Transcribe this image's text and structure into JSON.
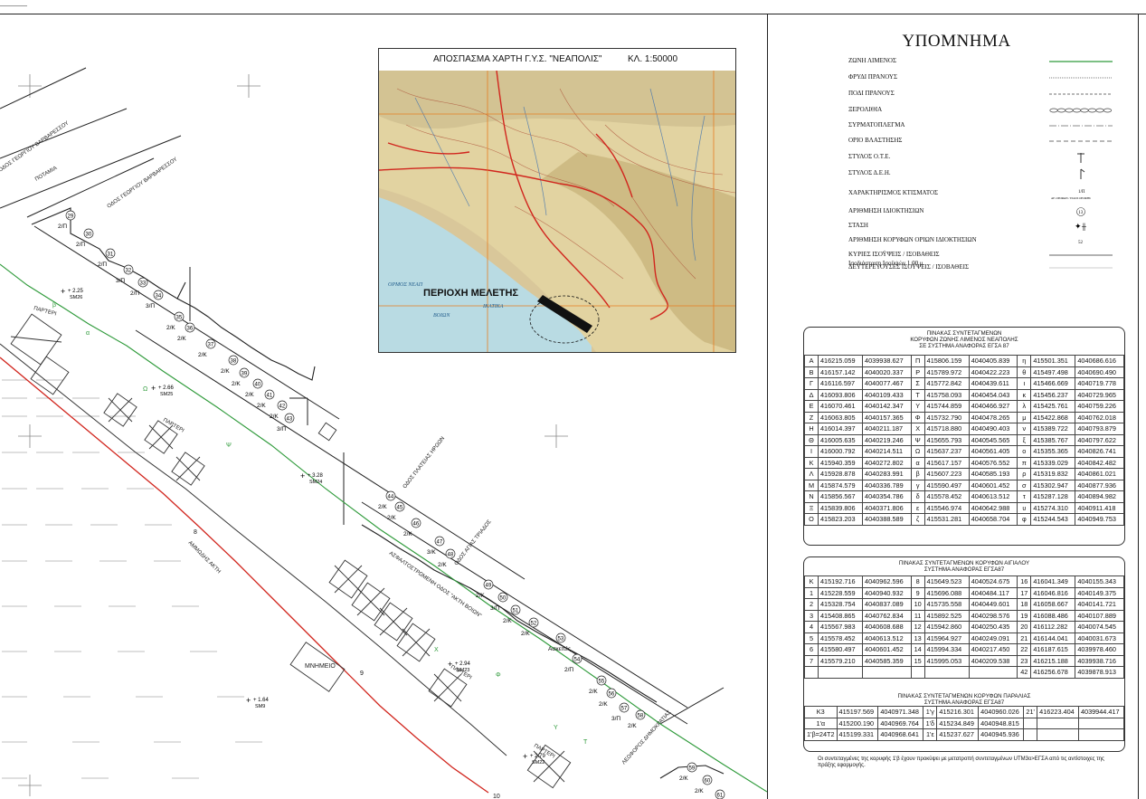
{
  "inset": {
    "title": "ΑΠΟΣΠΑΣΜΑ ΧΑΡΤΗ Γ.Υ.Σ. \"ΝΕΑΠΟΛΙΣ\"",
    "scale": "ΚΛ. 1:50000",
    "study_area_label": "ΠΕΡΙΟΧΗ ΜΕΛΕΤΗΣ",
    "sea_labels": [
      "ΟΡΜΟΣ ΝΕΑΠ",
      "ΒΟΙΩΝ",
      "ΙΚΑΤΙΚΑ"
    ]
  },
  "legend": {
    "title": "ΥΠΟΜΝΗΜΑ",
    "items": [
      {
        "label": "ΖΩΝΗ ΛΙΜΕΝΟΣ",
        "icon": "green-line"
      },
      {
        "label": "ΦΡΥΔΙ ΠΡΑΝΟΥΣ",
        "icon": "hatched-line"
      },
      {
        "label": "ΠΟΔΙ ΠΡΑΝΟΥΣ",
        "icon": "dashed-line"
      },
      {
        "label": "ΞΕΡΟΛΙΘΙΑ",
        "icon": "stone-wall"
      },
      {
        "label": "ΣΥΡΜΑΤΟΠΛΕΓΜΑ",
        "icon": "wire-fence"
      },
      {
        "label": "ΟΡΙΟ ΒΛΑΣΤΗΣΗΣ",
        "icon": "dash-line"
      },
      {
        "label": "ΣΤΥΛΟΣ Ο.Τ.Ε.",
        "icon": "ote-pole"
      },
      {
        "label": "ΣΤΥΛΟΣ Δ.Ε.Η.",
        "icon": "dei-pole"
      },
      {
        "label": "ΧΑΡΑΚΤΗΡΙΣΜΟΣ ΚΤΙΣΜΑΤΟΣ",
        "icon": "building-code",
        "symbol_text": "1/Π",
        "symbol_caption": "ΑΡ. ΟΡΟΦΩΝ / ΕΙΔΟΣ ΟΡΟΦΗΣ"
      },
      {
        "label": "ΑΡΙΘΜΗΣΗ ΙΔΙΟΚΤΗΣΙΩΝ",
        "icon": "circled-number",
        "symbol_text": "13"
      },
      {
        "label": "ΣΤΑΣΗ",
        "icon": "station"
      },
      {
        "label": "ΑΡΙΘΜΗΣΗ ΚΟΡΥΦΩΝ ΟΡΙΩΝ ΙΔΙΟΚΤΗΣΙΩΝ",
        "icon": "vertex-number",
        "symbol_text": "52"
      },
      {
        "label": "ΚΥΡΙΕΣ ΙΣΟΫΨΕΙΣ / ΙΣΟΒΑΘΕΙΣ",
        "icon": "solid-line"
      },
      {
        "label": "ΔΕΥΤΕΡΕΥΟΥΣΕΣ ΙΣΟΫΨΕΙΣ / ΙΣΟΒΑΘΕΙΣ",
        "icon": "thin-line"
      }
    ],
    "note": "Ισοδιάσταση Ισοϋψών 1.00 μ."
  },
  "table1": {
    "title_lines": [
      "ΠΙΝΑΚΑΣ ΣΥΝΤΕΤΑΓΜΕΝΩΝ",
      "ΚΟΡΥΦΩΝ ΖΩΝΗΣ ΛΙΜΕΝΟΣ ΝΕΑΠΟΛΗΣ",
      "ΣΕ ΣΥΣΤΗΜΑ ΑΝΑΦΟΡΑΣ ΕΓΣΑ 87"
    ],
    "rows": [
      [
        "Α",
        "416215.059",
        "4039938.627",
        "Π",
        "415806.159",
        "4040405.839",
        "η",
        "415501.351",
        "4040686.616"
      ],
      [
        "Β",
        "416157.142",
        "4040020.337",
        "Ρ",
        "415789.972",
        "4040422.223",
        "θ",
        "415497.498",
        "4040690.490"
      ],
      [
        "Γ",
        "416116.597",
        "4040077.467",
        "Σ",
        "415772.842",
        "4040439.611",
        "ι",
        "415466.669",
        "4040719.778"
      ],
      [
        "Δ",
        "416093.806",
        "4040109.433",
        "Τ",
        "415758.093",
        "4040454.043",
        "κ",
        "415456.237",
        "4040729.965"
      ],
      [
        "Ε",
        "416070.461",
        "4040142.347",
        "Υ",
        "415744.859",
        "4040466.927",
        "λ",
        "415425.761",
        "4040759.226"
      ],
      [
        "Ζ",
        "416063.805",
        "4040157.365",
        "Φ",
        "415732.790",
        "4040478.265",
        "μ",
        "415422.868",
        "4040762.018"
      ],
      [
        "Η",
        "416014.397",
        "4040211.187",
        "Χ",
        "415718.880",
        "4040490.403",
        "ν",
        "415389.722",
        "4040793.879"
      ],
      [
        "Θ",
        "416005.635",
        "4040219.246",
        "Ψ",
        "415655.793",
        "4040545.565",
        "ξ",
        "415385.767",
        "4040797.622"
      ],
      [
        "Ι",
        "416000.792",
        "4040214.511",
        "Ω",
        "415637.237",
        "4040561.405",
        "ο",
        "415355.365",
        "4040826.741"
      ],
      [
        "Κ",
        "415940.359",
        "4040272.802",
        "α",
        "415617.157",
        "4040576.552",
        "π",
        "415339.029",
        "4040842.482"
      ],
      [
        "Λ",
        "415928.878",
        "4040283.991",
        "β",
        "415607.223",
        "4040585.193",
        "ρ",
        "415319.832",
        "4040861.021"
      ],
      [
        "Μ",
        "415874.579",
        "4040336.789",
        "γ",
        "415590.497",
        "4040601.452",
        "σ",
        "415302.947",
        "4040877.936"
      ],
      [
        "Ν",
        "415856.567",
        "4040354.786",
        "δ",
        "415578.452",
        "4040613.512",
        "τ",
        "415287.128",
        "4040894.982"
      ],
      [
        "Ξ",
        "415839.806",
        "4040371.806",
        "ε",
        "415546.974",
        "4040642.988",
        "υ",
        "415274.310",
        "4040911.418"
      ],
      [
        "Ο",
        "415823.203",
        "4040388.589",
        "ζ",
        "415531.281",
        "4040658.704",
        "φ",
        "415244.543",
        "4040949.753"
      ]
    ]
  },
  "table2": {
    "title_lines": [
      "ΠΙΝΑΚΑΣ ΣΥΝΤΕΤΑΓΜΕΝΩΝ ΚΟΡΥΦΩΝ ΑΙΓΙΑΛΟΥ",
      "ΣΥΣΤΗΜΑ ΑΝΑΦΟΡΑΣ ΕΓΣΑ87"
    ],
    "rows": [
      [
        "Κ",
        "415192.716",
        "4040962.596",
        "8",
        "415649.523",
        "4040524.675",
        "16",
        "416041.349",
        "4040155.343"
      ],
      [
        "1",
        "415228.559",
        "4040940.932",
        "9",
        "415696.088",
        "4040484.117",
        "17",
        "416046.816",
        "4040149.375"
      ],
      [
        "2",
        "415328.754",
        "4040837.089",
        "10",
        "415735.558",
        "4040449.601",
        "18",
        "416058.667",
        "4040141.721"
      ],
      [
        "3",
        "415408.865",
        "4040762.834",
        "11",
        "415892.525",
        "4040298.576",
        "19",
        "416088.486",
        "4040107.889"
      ],
      [
        "4",
        "415567.983",
        "4040608.688",
        "12",
        "415942.860",
        "4040250.435",
        "20",
        "416112.282",
        "4040074.545"
      ],
      [
        "5",
        "415578.452",
        "4040613.512",
        "13",
        "415964.927",
        "4040249.091",
        "21",
        "416144.041",
        "4040031.673"
      ],
      [
        "6",
        "415580.497",
        "4040601.452",
        "14",
        "415994.334",
        "4040217.450",
        "22",
        "416187.615",
        "4039978.460"
      ],
      [
        "7",
        "415579.210",
        "4040585.359",
        "15",
        "415995.053",
        "4040209.538",
        "23",
        "416215.188",
        "4039938.716"
      ],
      [
        "",
        "",
        "",
        "",
        "",
        "",
        "42",
        "416256.678",
        "4039878.913"
      ]
    ],
    "sub_title_lines": [
      "ΠΙΝΑΚΑΣ ΣΥΝΤΕΤΑΓΜΕΝΩΝ ΚΟΡΥΦΩΝ ΠΑΡΑΛΙΑΣ",
      "ΣΥΣΤΗΜΑ ΑΝΑΦΟΡΑΣ ΕΓΣΑ87"
    ],
    "sub_rows": [
      [
        "Κ3",
        "415197.569",
        "4040971.348",
        "1'γ",
        "415216.301",
        "4040960.026",
        "21'",
        "416223.404",
        "4039944.417"
      ],
      [
        "1'α",
        "415200.190",
        "4040969.764",
        "1'δ",
        "415234.849",
        "4040948.815",
        "",
        "",
        ""
      ],
      [
        "1'β=24Τ2",
        "415199.331",
        "4040968.641",
        "1'ε",
        "415237.627",
        "4040945.936",
        "",
        "",
        ""
      ]
    ]
  },
  "footnote": "Οι συντεταγμένες της κορυφής 1'β έχουν προκύψει με μετατροπή συντεταγμένων UTM3o>ΕΓΣΑ από τις αντίστοιχες της πράξης εφαρμογής.",
  "map": {
    "street_labels": [
      "ΟΔΟΣ ΓΕΩΡΓΙΟΥ ΒΑΡΒΑΡΕΣΣΟΥ",
      "ΟΔΟΣ ΓΕΩΡΓΙΟΥ ΒΑΡΒΑΡΕΣΣΟΥ",
      "ΠΟΤΑΜΙΑ",
      "ΟΔΟΣ ΠΛΑΤΕΙΑΣ ΗΡΩΩΝ",
      "ΟΔΟΣ ΑΓΙΑΣ ΤΡΙΑΔΟΣ",
      "ΑΣΦΑΛΤΟΣΤΡΩΜΕΝΗ ΟΔΟΣ \"ΑΚΤΗ ΒΟΙΩΝ\"",
      "ΑΜΜΩΔΗΣ ΑΚΤΗ",
      "ΛΕΩΦΟΡΟΣ ΔΗΜΟΚΡΑΤΙΑΣ",
      "ΜΝΗΜΕΙΟ",
      "Ασκεπές",
      "ΠΑΡΤΕΡΙ"
    ],
    "parcels": [
      {
        "num": "29",
        "code": "2/Π"
      },
      {
        "num": "30",
        "code": "2/Π"
      },
      {
        "num": "31",
        "code": "2/Π"
      },
      {
        "num": "32",
        "code": "3/Π"
      },
      {
        "num": "33",
        "code": "2/Π"
      },
      {
        "num": "34",
        "code": "3/Π"
      },
      {
        "num": "35",
        "code": "2/Κ"
      },
      {
        "num": "36",
        "code": "2/Κ"
      },
      {
        "num": "37",
        "code": "2/Κ"
      },
      {
        "num": "38",
        "code": "2/Κ"
      },
      {
        "num": "39",
        "code": "2/Κ"
      },
      {
        "num": "40",
        "code": "2/Κ"
      },
      {
        "num": "41",
        "code": "2/Κ"
      },
      {
        "num": "42",
        "code": "2/Κ"
      },
      {
        "num": "43",
        "code": "3/Π"
      },
      {
        "num": "44",
        "code": "2/Κ"
      },
      {
        "num": "45",
        "code": "2/Κ"
      },
      {
        "num": "46",
        "code": "2/Κ"
      },
      {
        "num": "47",
        "code": "3/Κ"
      },
      {
        "num": "48",
        "code": "2/Κ"
      },
      {
        "num": "49",
        "code": "2/Κ"
      },
      {
        "num": "50",
        "code": "3/Π"
      },
      {
        "num": "51",
        "code": "2/Κ"
      },
      {
        "num": "52",
        "code": "2/Κ"
      },
      {
        "num": "53",
        "code": "Ασκεπές"
      },
      {
        "num": "54",
        "code": "2/Π"
      },
      {
        "num": "55",
        "code": "2/Κ"
      },
      {
        "num": "56",
        "code": "2/Κ"
      },
      {
        "num": "57",
        "code": "3/Π"
      },
      {
        "num": "58",
        "code": "2/Κ"
      },
      {
        "num": "59",
        "code": "2/Κ"
      },
      {
        "num": "60",
        "code": "2/Κ"
      },
      {
        "num": "61",
        "code": ""
      }
    ],
    "stations": [
      {
        "elev": "+ 2.25",
        "name": "SM26"
      },
      {
        "elev": "+ 2.66",
        "name": "SM25"
      },
      {
        "elev": "+ 3.28",
        "name": "SM24"
      },
      {
        "elev": "+ 2.94",
        "name": "SM23"
      },
      {
        "elev": "+ 2.79",
        "name": "SM22"
      },
      {
        "elev": "+ 1.64",
        "name": "SM9"
      }
    ],
    "zone_letters": [
      "β",
      "α",
      "Ω",
      "Ψ",
      "Φ",
      "Υ",
      "Τ",
      "X"
    ],
    "shore_labels": [
      "8",
      "9",
      "10"
    ]
  }
}
